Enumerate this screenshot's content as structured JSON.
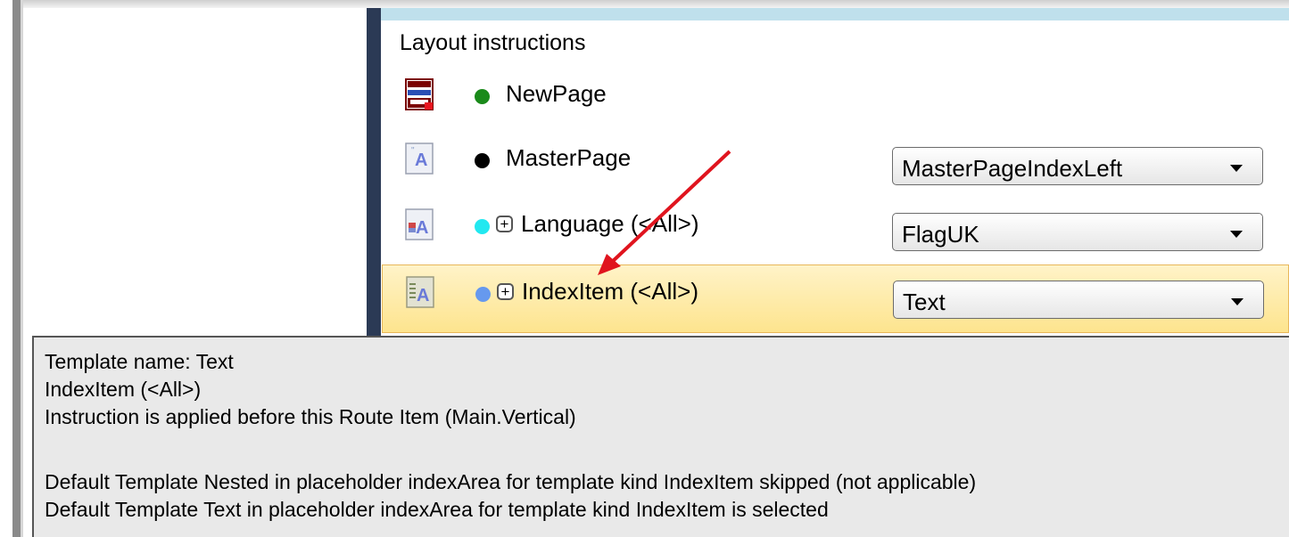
{
  "panel": {
    "title": "Layout instructions"
  },
  "rows": [
    {
      "label": "NewPage",
      "dot_color": "#1a8a1a",
      "icon": "new-page-icon"
    },
    {
      "label": "MasterPage",
      "dot_color": "#000000",
      "icon": "text-frame-icon",
      "value": "MasterPageIndexLeft"
    },
    {
      "label": "Language (<All>)",
      "dot_color": "#22e8f0",
      "icon": "language-frame-icon",
      "expand": "+",
      "value": "FlagUK"
    },
    {
      "label": "IndexItem (<All>)",
      "dot_color": "#6699ee",
      "icon": "index-frame-icon",
      "expand": "+",
      "value": "Text"
    }
  ],
  "tooltip": {
    "lines": [
      "Template name: Text",
      "IndexItem (<All>)",
      "Instruction is applied before this Route Item (Main.Vertical)",
      "",
      "Default Template Nested in placeholder indexArea for template kind IndexItem skipped (not applicable)",
      "Default Template Text in placeholder indexArea for template kind IndexItem is selected"
    ]
  },
  "colors": {
    "selected_row": "#fde48e",
    "annotation_arrow": "#e0141e",
    "splitter": "#2b3a55"
  }
}
